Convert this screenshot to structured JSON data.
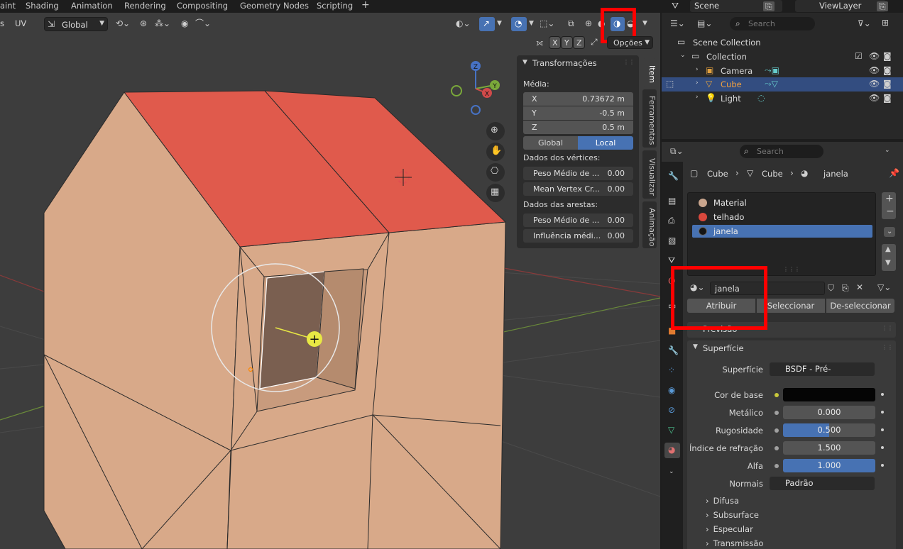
{
  "workspace_tabs": [
    "aint",
    "Shading",
    "Animation",
    "Rendering",
    "Compositing",
    "Geometry Nodes",
    "Scripting",
    "+"
  ],
  "scene": {
    "name": "Scene",
    "view_layer": "ViewLayer"
  },
  "viewport_header": {
    "left_labels": [
      "s",
      "UV"
    ],
    "orientation": "Global",
    "options_label": "Opções",
    "axes": [
      "X",
      "Y",
      "Z"
    ]
  },
  "gizmo": {
    "axes": [
      "Z",
      "Y",
      "X"
    ]
  },
  "npanel": {
    "section_title": "Transformações",
    "median_label": "Média:",
    "coords": [
      {
        "axis": "X",
        "value": "0.73672 m"
      },
      {
        "axis": "Y",
        "value": "-0.5 m"
      },
      {
        "axis": "Z",
        "value": "0.5 m"
      }
    ],
    "space_global": "Global",
    "space_local": "Local",
    "vertex_data_label": "Dados dos vértices:",
    "vertex_fields": [
      {
        "label": "Peso Médio de ...",
        "value": "0.00"
      },
      {
        "label": "Mean Vertex Cr...",
        "value": "0.00"
      }
    ],
    "edge_data_label": "Dados das arestas:",
    "edge_fields": [
      {
        "label": "Peso Médio de ...",
        "value": "0.00"
      },
      {
        "label": "Influência médi...",
        "value": "0.00"
      }
    ],
    "side_tabs": [
      "Item",
      "Ferramentas",
      "Visualizar",
      "Animação"
    ]
  },
  "outliner": {
    "search_placeholder": "Search",
    "scene_collection": "Scene Collection",
    "collection": "Collection",
    "items": [
      {
        "name": "Camera",
        "selected": false
      },
      {
        "name": "Cube",
        "selected": true
      },
      {
        "name": "Light",
        "selected": false
      }
    ]
  },
  "properties": {
    "search_placeholder": "Search",
    "breadcrumb": [
      "Cube",
      "Cube",
      "janela"
    ],
    "material_slots": [
      {
        "name": "Material",
        "color": "#c9a58d",
        "selected": false
      },
      {
        "name": "telhado",
        "color": "#d9483c",
        "selected": false
      },
      {
        "name": "janela",
        "color": "#151515",
        "selected": true
      }
    ],
    "material_name": "janela",
    "assign_label": "Atribuir",
    "select_label": "Seleccionar",
    "deselect_label": "De-seleccionar",
    "preview_label": "Previsão",
    "surface_section": "Superfície",
    "surface_label": "Superfície",
    "surface_value": "BSDF - Pré-fundame...",
    "base_color_label": "Cor de base",
    "fields": [
      {
        "label": "Metálico",
        "value": "0.000",
        "fill": 0.0
      },
      {
        "label": "Rugosidade",
        "value": "0.500",
        "fill": 0.5
      },
      {
        "label": "Índice de refração",
        "value": "1.500",
        "fill": 0.0
      },
      {
        "label": "Alfa",
        "value": "1.000",
        "fill": 1.0
      }
    ],
    "normals_label": "Normais",
    "normals_value": "Padrão",
    "subsections": [
      "Difusa",
      "Subsurface",
      "Especular",
      "Transmissão"
    ]
  },
  "colors": {
    "accent": "#4772b3",
    "highlight_box": "#ff0000",
    "wall": "#d8a989",
    "roof": "#e05a4c"
  }
}
